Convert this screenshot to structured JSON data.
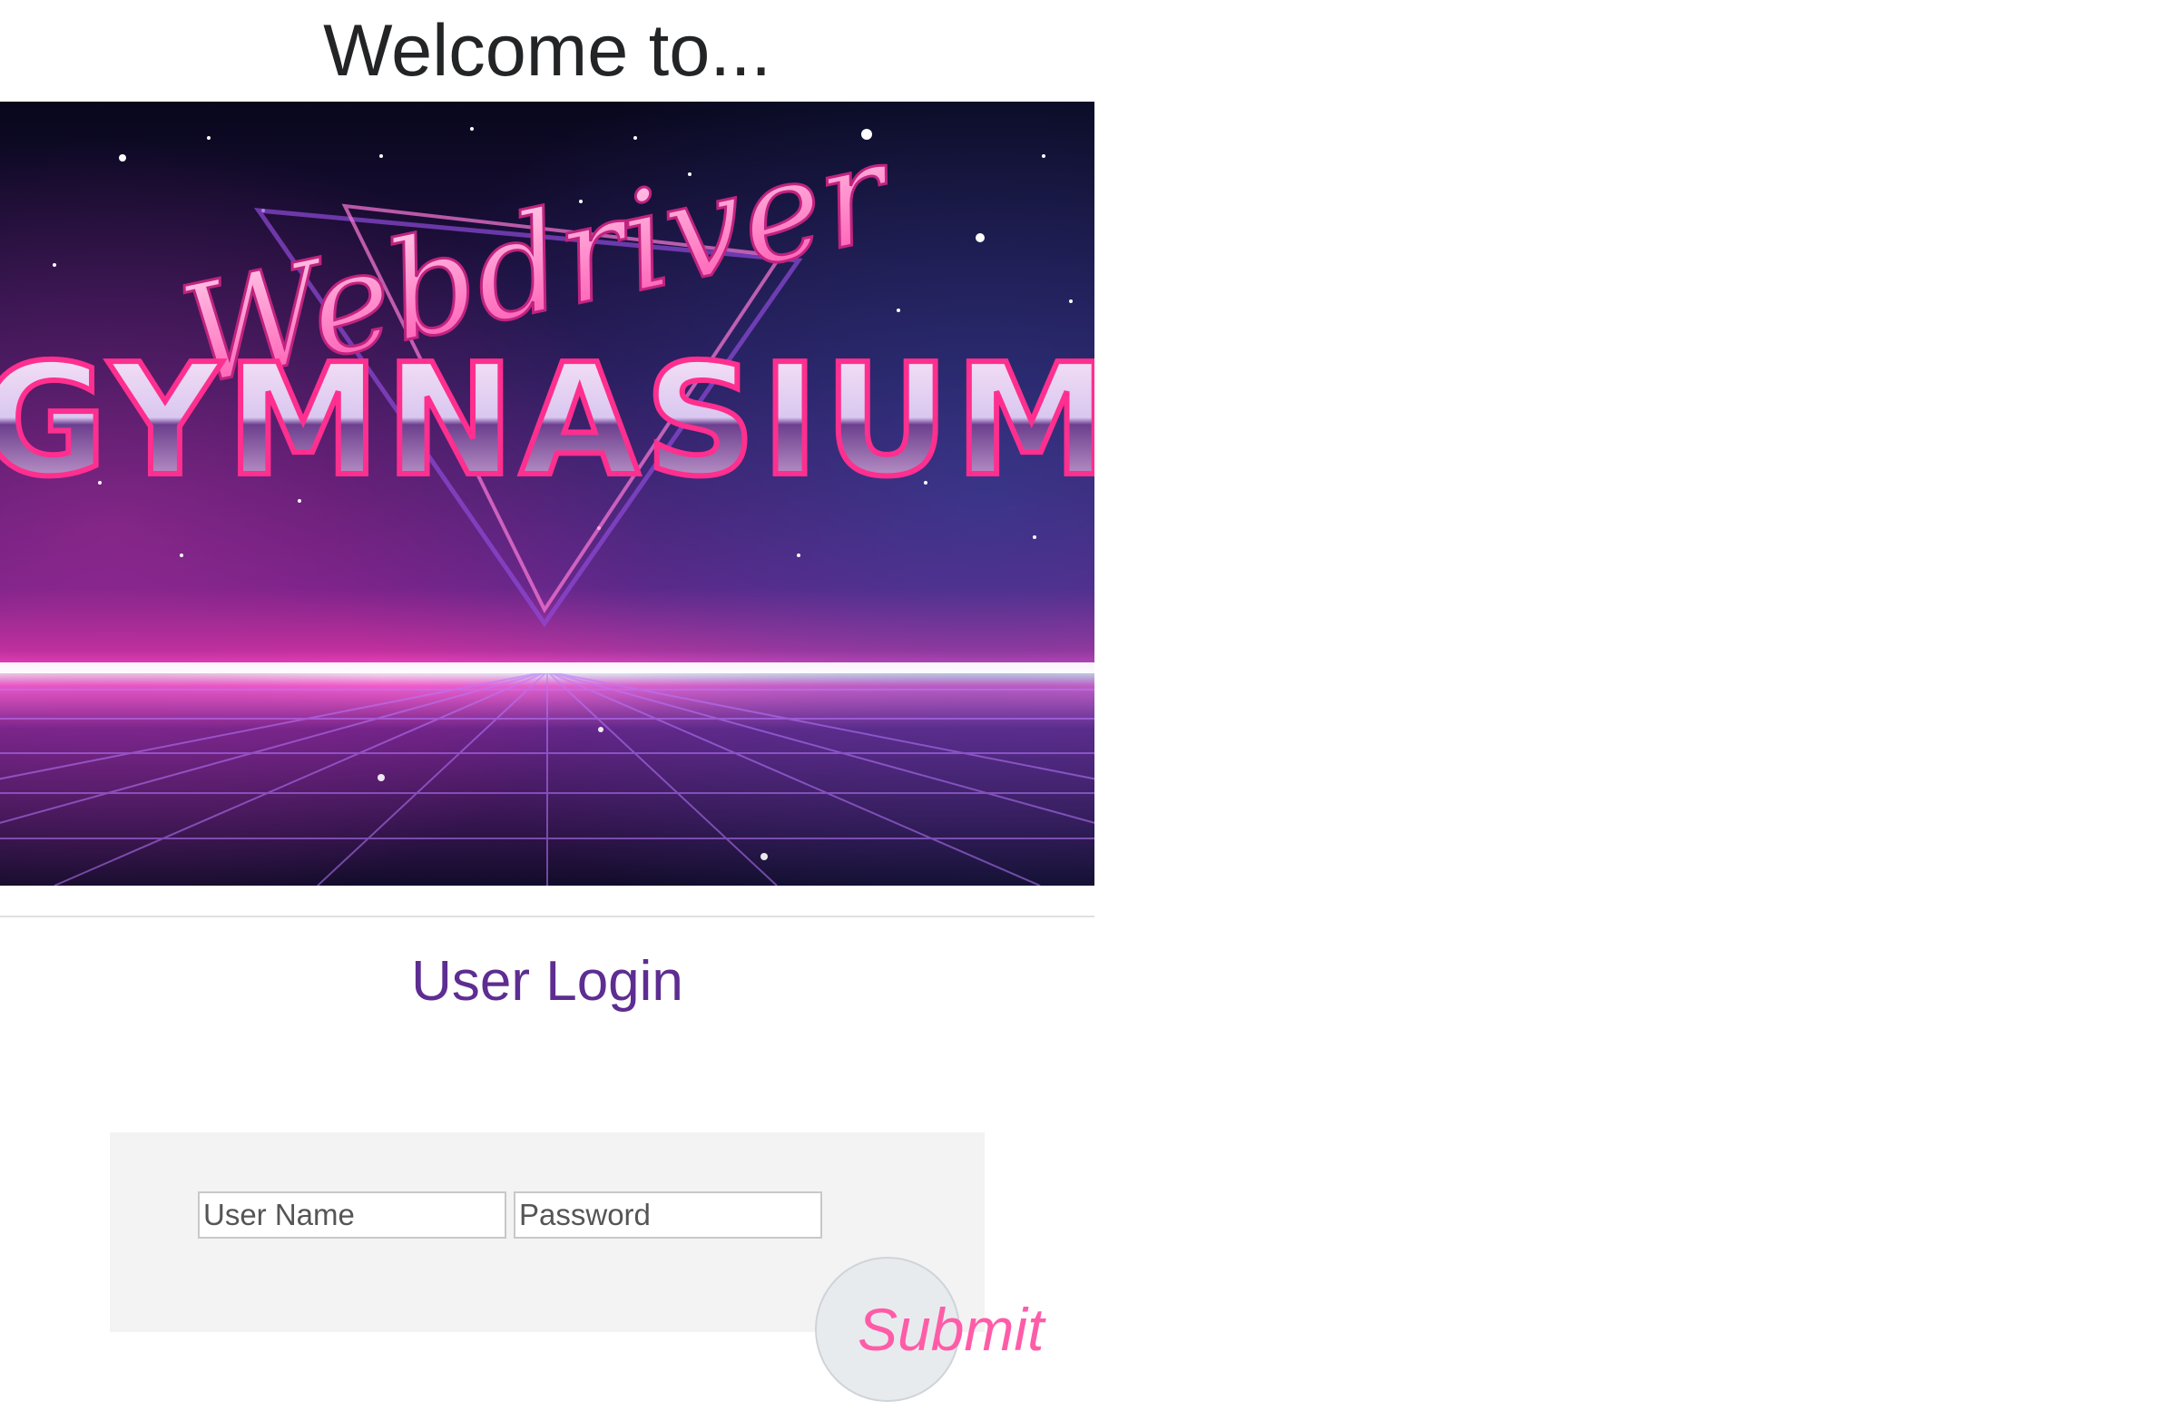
{
  "header": {
    "welcome_text": "Welcome to..."
  },
  "banner": {
    "script_word": "Webdriver",
    "block_word": "GYMNASIUM"
  },
  "login": {
    "title": "User Login",
    "username_placeholder": "User Name",
    "password_placeholder": "Password",
    "submit_label": "Submit"
  },
  "colors": {
    "login_title": "#5e2d91",
    "submit_text": "#ff5ca8",
    "panel_bg": "#f3f3f3",
    "banner_sky_top": "#0a0820",
    "banner_horizon": "#ff45c8",
    "banner_text_pink": "#ff6fbd"
  }
}
